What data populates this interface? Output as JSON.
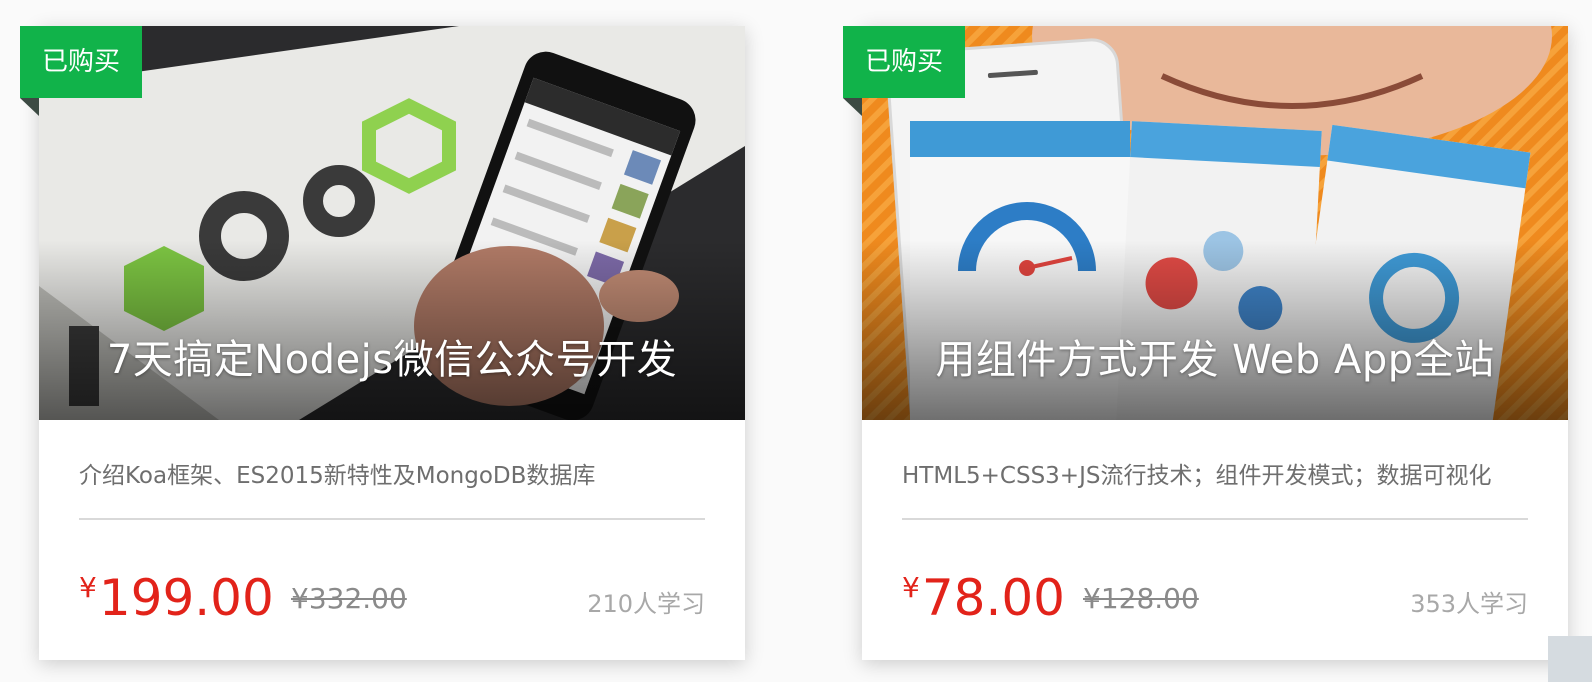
{
  "courses": [
    {
      "badge": "已购买",
      "title": "7天搞定Nodejs微信公众号开发",
      "description": "介绍Koa框架、ES2015新特性及MongoDB数据库",
      "price_symbol": "¥",
      "price": "199.00",
      "original_price": "¥332.00",
      "learners": "210人学习"
    },
    {
      "badge": "已购买",
      "title": "用组件方式开发 Web App全站",
      "description": "HTML5+CSS3+JS流行技术；组件开发模式；数据可视化",
      "price_symbol": "¥",
      "price": "78.00",
      "original_price": "¥128.00",
      "learners": "353人学习"
    }
  ],
  "colors": {
    "badge_green": "#11b34a",
    "price_red": "#e2231a",
    "muted_text": "#6e6e6e"
  }
}
